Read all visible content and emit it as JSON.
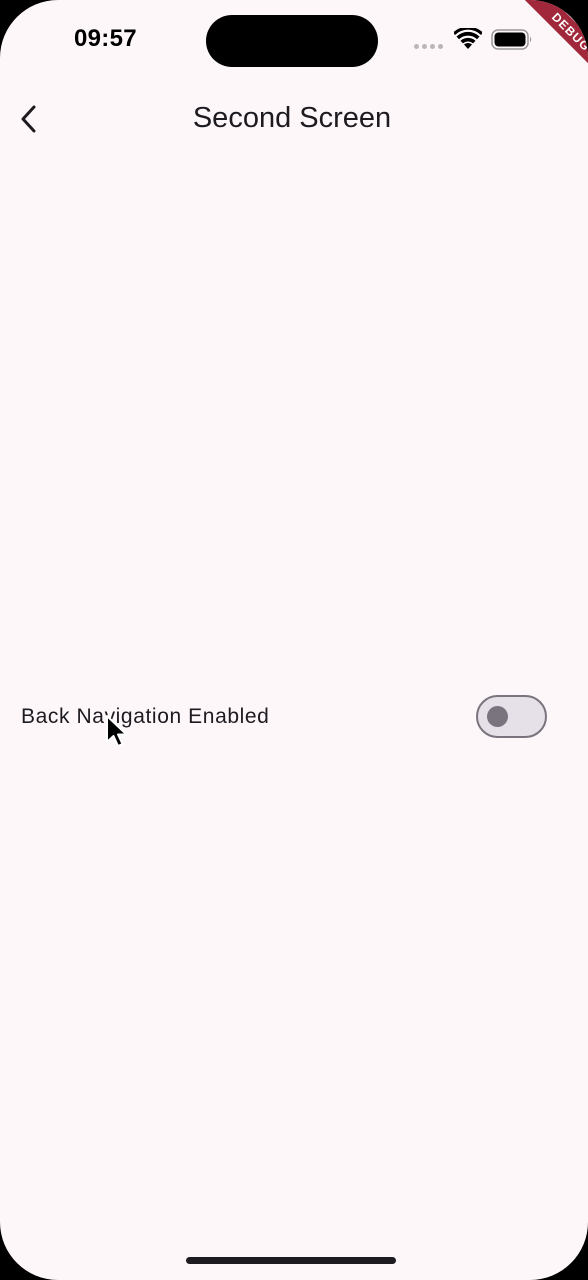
{
  "status_bar": {
    "time": "09:57",
    "icons": [
      "cellular-signal-icon",
      "wifi-icon",
      "battery-icon"
    ]
  },
  "debug_banner": {
    "label": "DEBUG",
    "color": "#a0283a"
  },
  "app_bar": {
    "back_icon": "chevron-left-icon",
    "title": "Second Screen"
  },
  "settings": {
    "back_navigation": {
      "label": "Back Navigation Enabled",
      "enabled": false
    }
  },
  "theme": {
    "background": "#fdf7fa",
    "text": "#1d1b20",
    "switch_outline": "#79747e",
    "switch_track_off": "#e6e0e9"
  }
}
